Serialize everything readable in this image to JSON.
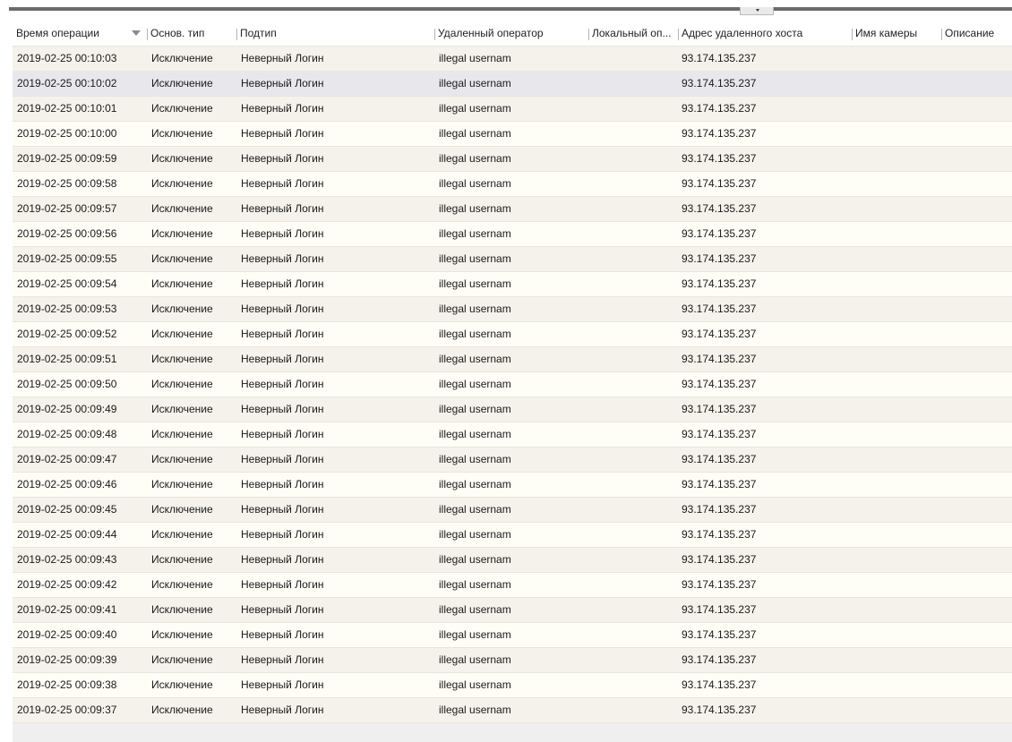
{
  "columns": [
    {
      "key": "time",
      "label": "Время операции"
    },
    {
      "key": "main_type",
      "label": "Основ. тип"
    },
    {
      "key": "subtype",
      "label": "Подтип"
    },
    {
      "key": "remote_operator",
      "label": "Удаленный оператор"
    },
    {
      "key": "local_operator",
      "label": "Локальный оп..."
    },
    {
      "key": "remote_host",
      "label": "Адрес удаленного хоста"
    },
    {
      "key": "camera_name",
      "label": "Имя камеры"
    },
    {
      "key": "description",
      "label": "Описание"
    }
  ],
  "sort": {
    "column": "time",
    "direction": "desc",
    "icon": "sort-desc-icon"
  },
  "selected_row": 1,
  "rows": [
    {
      "time": "2019-02-25 00:10:03",
      "main_type": "Исключение",
      "subtype": "Неверный Логин",
      "remote_operator": "illegal usernam",
      "local_operator": "",
      "remote_host": "93.174.135.237",
      "camera_name": "",
      "description": ""
    },
    {
      "time": "2019-02-25 00:10:02",
      "main_type": "Исключение",
      "subtype": "Неверный Логин",
      "remote_operator": "illegal usernam",
      "local_operator": "",
      "remote_host": "93.174.135.237",
      "camera_name": "",
      "description": ""
    },
    {
      "time": "2019-02-25 00:10:01",
      "main_type": "Исключение",
      "subtype": "Неверный Логин",
      "remote_operator": "illegal usernam",
      "local_operator": "",
      "remote_host": "93.174.135.237",
      "camera_name": "",
      "description": ""
    },
    {
      "time": "2019-02-25 00:10:00",
      "main_type": "Исключение",
      "subtype": "Неверный Логин",
      "remote_operator": "illegal usernam",
      "local_operator": "",
      "remote_host": "93.174.135.237",
      "camera_name": "",
      "description": ""
    },
    {
      "time": "2019-02-25 00:09:59",
      "main_type": "Исключение",
      "subtype": "Неверный Логин",
      "remote_operator": "illegal usernam",
      "local_operator": "",
      "remote_host": "93.174.135.237",
      "camera_name": "",
      "description": ""
    },
    {
      "time": "2019-02-25 00:09:58",
      "main_type": "Исключение",
      "subtype": "Неверный Логин",
      "remote_operator": "illegal usernam",
      "local_operator": "",
      "remote_host": "93.174.135.237",
      "camera_name": "",
      "description": ""
    },
    {
      "time": "2019-02-25 00:09:57",
      "main_type": "Исключение",
      "subtype": "Неверный Логин",
      "remote_operator": "illegal usernam",
      "local_operator": "",
      "remote_host": "93.174.135.237",
      "camera_name": "",
      "description": ""
    },
    {
      "time": "2019-02-25 00:09:56",
      "main_type": "Исключение",
      "subtype": "Неверный Логин",
      "remote_operator": "illegal usernam",
      "local_operator": "",
      "remote_host": "93.174.135.237",
      "camera_name": "",
      "description": ""
    },
    {
      "time": "2019-02-25 00:09:55",
      "main_type": "Исключение",
      "subtype": "Неверный Логин",
      "remote_operator": "illegal usernam",
      "local_operator": "",
      "remote_host": "93.174.135.237",
      "camera_name": "",
      "description": ""
    },
    {
      "time": "2019-02-25 00:09:54",
      "main_type": "Исключение",
      "subtype": "Неверный Логин",
      "remote_operator": "illegal usernam",
      "local_operator": "",
      "remote_host": "93.174.135.237",
      "camera_name": "",
      "description": ""
    },
    {
      "time": "2019-02-25 00:09:53",
      "main_type": "Исключение",
      "subtype": "Неверный Логин",
      "remote_operator": "illegal usernam",
      "local_operator": "",
      "remote_host": "93.174.135.237",
      "camera_name": "",
      "description": ""
    },
    {
      "time": "2019-02-25 00:09:52",
      "main_type": "Исключение",
      "subtype": "Неверный Логин",
      "remote_operator": "illegal usernam",
      "local_operator": "",
      "remote_host": "93.174.135.237",
      "camera_name": "",
      "description": ""
    },
    {
      "time": "2019-02-25 00:09:51",
      "main_type": "Исключение",
      "subtype": "Неверный Логин",
      "remote_operator": "illegal usernam",
      "local_operator": "",
      "remote_host": "93.174.135.237",
      "camera_name": "",
      "description": ""
    },
    {
      "time": "2019-02-25 00:09:50",
      "main_type": "Исключение",
      "subtype": "Неверный Логин",
      "remote_operator": "illegal usernam",
      "local_operator": "",
      "remote_host": "93.174.135.237",
      "camera_name": "",
      "description": ""
    },
    {
      "time": "2019-02-25 00:09:49",
      "main_type": "Исключение",
      "subtype": "Неверный Логин",
      "remote_operator": "illegal usernam",
      "local_operator": "",
      "remote_host": "93.174.135.237",
      "camera_name": "",
      "description": ""
    },
    {
      "time": "2019-02-25 00:09:48",
      "main_type": "Исключение",
      "subtype": "Неверный Логин",
      "remote_operator": "illegal usernam",
      "local_operator": "",
      "remote_host": "93.174.135.237",
      "camera_name": "",
      "description": ""
    },
    {
      "time": "2019-02-25 00:09:47",
      "main_type": "Исключение",
      "subtype": "Неверный Логин",
      "remote_operator": "illegal usernam",
      "local_operator": "",
      "remote_host": "93.174.135.237",
      "camera_name": "",
      "description": ""
    },
    {
      "time": "2019-02-25 00:09:46",
      "main_type": "Исключение",
      "subtype": "Неверный Логин",
      "remote_operator": "illegal usernam",
      "local_operator": "",
      "remote_host": "93.174.135.237",
      "camera_name": "",
      "description": ""
    },
    {
      "time": "2019-02-25 00:09:45",
      "main_type": "Исключение",
      "subtype": "Неверный Логин",
      "remote_operator": "illegal usernam",
      "local_operator": "",
      "remote_host": "93.174.135.237",
      "camera_name": "",
      "description": ""
    },
    {
      "time": "2019-02-25 00:09:44",
      "main_type": "Исключение",
      "subtype": "Неверный Логин",
      "remote_operator": "illegal usernam",
      "local_operator": "",
      "remote_host": "93.174.135.237",
      "camera_name": "",
      "description": ""
    },
    {
      "time": "2019-02-25 00:09:43",
      "main_type": "Исключение",
      "subtype": "Неверный Логин",
      "remote_operator": "illegal usernam",
      "local_operator": "",
      "remote_host": "93.174.135.237",
      "camera_name": "",
      "description": ""
    },
    {
      "time": "2019-02-25 00:09:42",
      "main_type": "Исключение",
      "subtype": "Неверный Логин",
      "remote_operator": "illegal usernam",
      "local_operator": "",
      "remote_host": "93.174.135.237",
      "camera_name": "",
      "description": ""
    },
    {
      "time": "2019-02-25 00:09:41",
      "main_type": "Исключение",
      "subtype": "Неверный Логин",
      "remote_operator": "illegal usernam",
      "local_operator": "",
      "remote_host": "93.174.135.237",
      "camera_name": "",
      "description": ""
    },
    {
      "time": "2019-02-25 00:09:40",
      "main_type": "Исключение",
      "subtype": "Неверный Логин",
      "remote_operator": "illegal usernam",
      "local_operator": "",
      "remote_host": "93.174.135.237",
      "camera_name": "",
      "description": ""
    },
    {
      "time": "2019-02-25 00:09:39",
      "main_type": "Исключение",
      "subtype": "Неверный Логин",
      "remote_operator": "illegal usernam",
      "local_operator": "",
      "remote_host": "93.174.135.237",
      "camera_name": "",
      "description": ""
    },
    {
      "time": "2019-02-25 00:09:38",
      "main_type": "Исключение",
      "subtype": "Неверный Логин",
      "remote_operator": "illegal usernam",
      "local_operator": "",
      "remote_host": "93.174.135.237",
      "camera_name": "",
      "description": ""
    },
    {
      "time": "2019-02-25 00:09:37",
      "main_type": "Исключение",
      "subtype": "Неверный Логин",
      "remote_operator": "illegal usernam",
      "local_operator": "",
      "remote_host": "93.174.135.237",
      "camera_name": "",
      "description": ""
    }
  ]
}
